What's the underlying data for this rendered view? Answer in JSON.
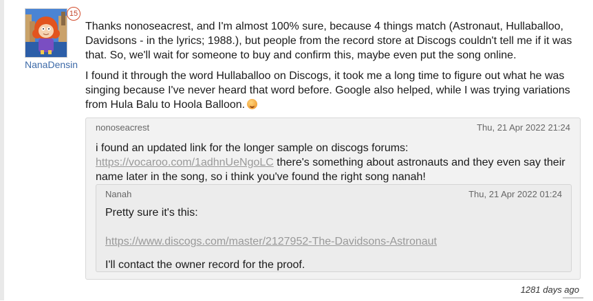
{
  "author": {
    "username": "NanaDensin",
    "badge_count": "15"
  },
  "post": {
    "paragraph1": "Thanks nonoseacrest, and I'm almost 100% sure, because 4 things match (Astronaut, Hullaballoo, Davidsons - in the lyrics; 1988.), but people from the record store at Discogs couldn't tell me if it was that. So, we'll wait for someone to buy and confirm this, maybe even put the song online.",
    "paragraph2": "I found it through the word Hullaballoo on Discogs, it took me a long time to figure out what he was singing because I've never heard that word before. Google also helped, while I was trying variations from Hula Balu to Hoola Balloon."
  },
  "quote1": {
    "author": "nonoseacrest",
    "date": "Thu, 21 Apr 2022 21:24",
    "text_before": "i found an updated link for the longer sample on discogs forums: ",
    "link": "https://vocaroo.com/1adhnUeNgoLC",
    "text_after": " there's something about astronauts and they even say their name later in the song, so i think you've found the right song nanah!"
  },
  "quote2": {
    "author": "Nanah",
    "date": "Thu, 21 Apr 2022 01:24",
    "line1": "Pretty sure it's this:",
    "link": "https://www.discogs.com/master/2127952-The-Davidsons-Astronaut",
    "line3": "I'll contact the owner record for the proof."
  },
  "footer": {
    "age": "1281 days ago"
  },
  "icons": {
    "emoji": "smiling-face-icon"
  },
  "colors": {
    "username": "#3d6aa8",
    "link": "#999999",
    "badge": "#c24226",
    "quote_bg": "#f2f2f2",
    "nested_quote_bg": "#ececec"
  }
}
